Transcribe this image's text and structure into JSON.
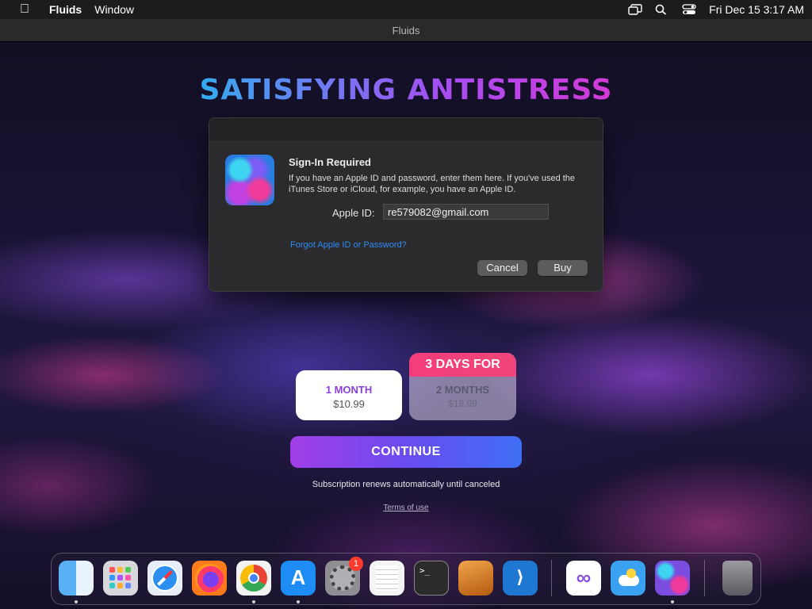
{
  "menubar": {
    "app_name": "Fluids",
    "menu_window": "Window",
    "datetime": "Fri Dec 15  3:17 AM"
  },
  "window": {
    "title": "Fluids"
  },
  "app": {
    "title": "SATISFYING ANTISTRESS",
    "plans": [
      {
        "title": "1 MONTH",
        "price": "$10.99",
        "selected": true
      },
      {
        "badge": "3 DAYS FOR",
        "title": "2 MONTHS",
        "price": "$19.99",
        "selected": false
      }
    ],
    "continue_label": "CONTINUE",
    "renew_text": "Subscription renews automatically until canceled",
    "terms_label": "Terms of use"
  },
  "dialog": {
    "heading": "Sign-In Required",
    "body": "If you have an Apple ID and password, enter them here. If you've used the iTunes Store or iCloud, for example, you have an Apple ID.",
    "apple_id_label": "Apple ID:",
    "apple_id_value": "re579082@gmail.com",
    "forgot_link": "Forgot Apple ID or Password?",
    "cancel_label": "Cancel",
    "buy_label": "Buy"
  },
  "dock": {
    "items": [
      {
        "name": "finder-icon",
        "color": "#2a8cf0"
      },
      {
        "name": "launchpad-icon",
        "color": "#d8d8dc"
      },
      {
        "name": "safari-icon",
        "color": "#e8eef8"
      },
      {
        "name": "firefox-icon",
        "color": "#ff7a1a"
      },
      {
        "name": "chrome-icon",
        "color": "#f2f2f2"
      },
      {
        "name": "app-store-icon",
        "color": "#1e8cf5"
      },
      {
        "name": "system-settings-icon",
        "color": "#8e8e93"
      },
      {
        "name": "textedit-icon",
        "color": "#f4f4f4"
      },
      {
        "name": "terminal-icon",
        "color": "#2b2b2b"
      },
      {
        "name": "garageband-icon",
        "color": "#e07a1a"
      },
      {
        "name": "vscode-icon",
        "color": "#1e78d2"
      },
      {
        "name": "visual-studio-icon",
        "color": "#ffffff"
      },
      {
        "name": "weather-icon",
        "color": "#3aa0f0"
      },
      {
        "name": "fluids-icon",
        "color": "#8a40e0"
      },
      {
        "name": "trash-icon",
        "color": "#6e6e72"
      }
    ],
    "settings_badge": "1"
  }
}
